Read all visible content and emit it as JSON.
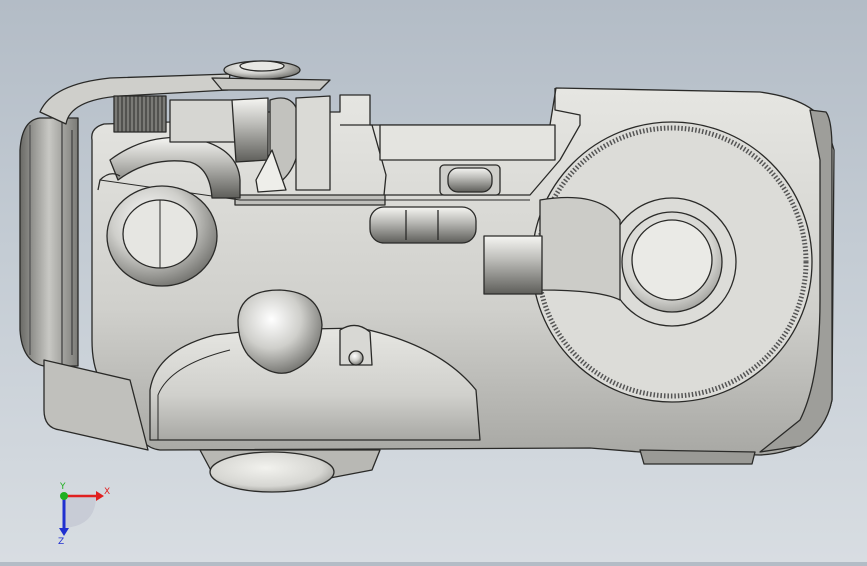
{
  "viewport": {
    "background_top": "#b3bcc6",
    "background_bottom": "#d8dde2"
  },
  "model": {
    "body_color": "#d4d4d0",
    "edge_color": "#2a2a28",
    "dial_color": "#dcdcd8"
  },
  "triad": {
    "x_label": "X",
    "y_label": "Y",
    "z_label": "Z",
    "x_color": "#e02020",
    "y_color": "#20b020",
    "z_color": "#2030d0"
  }
}
